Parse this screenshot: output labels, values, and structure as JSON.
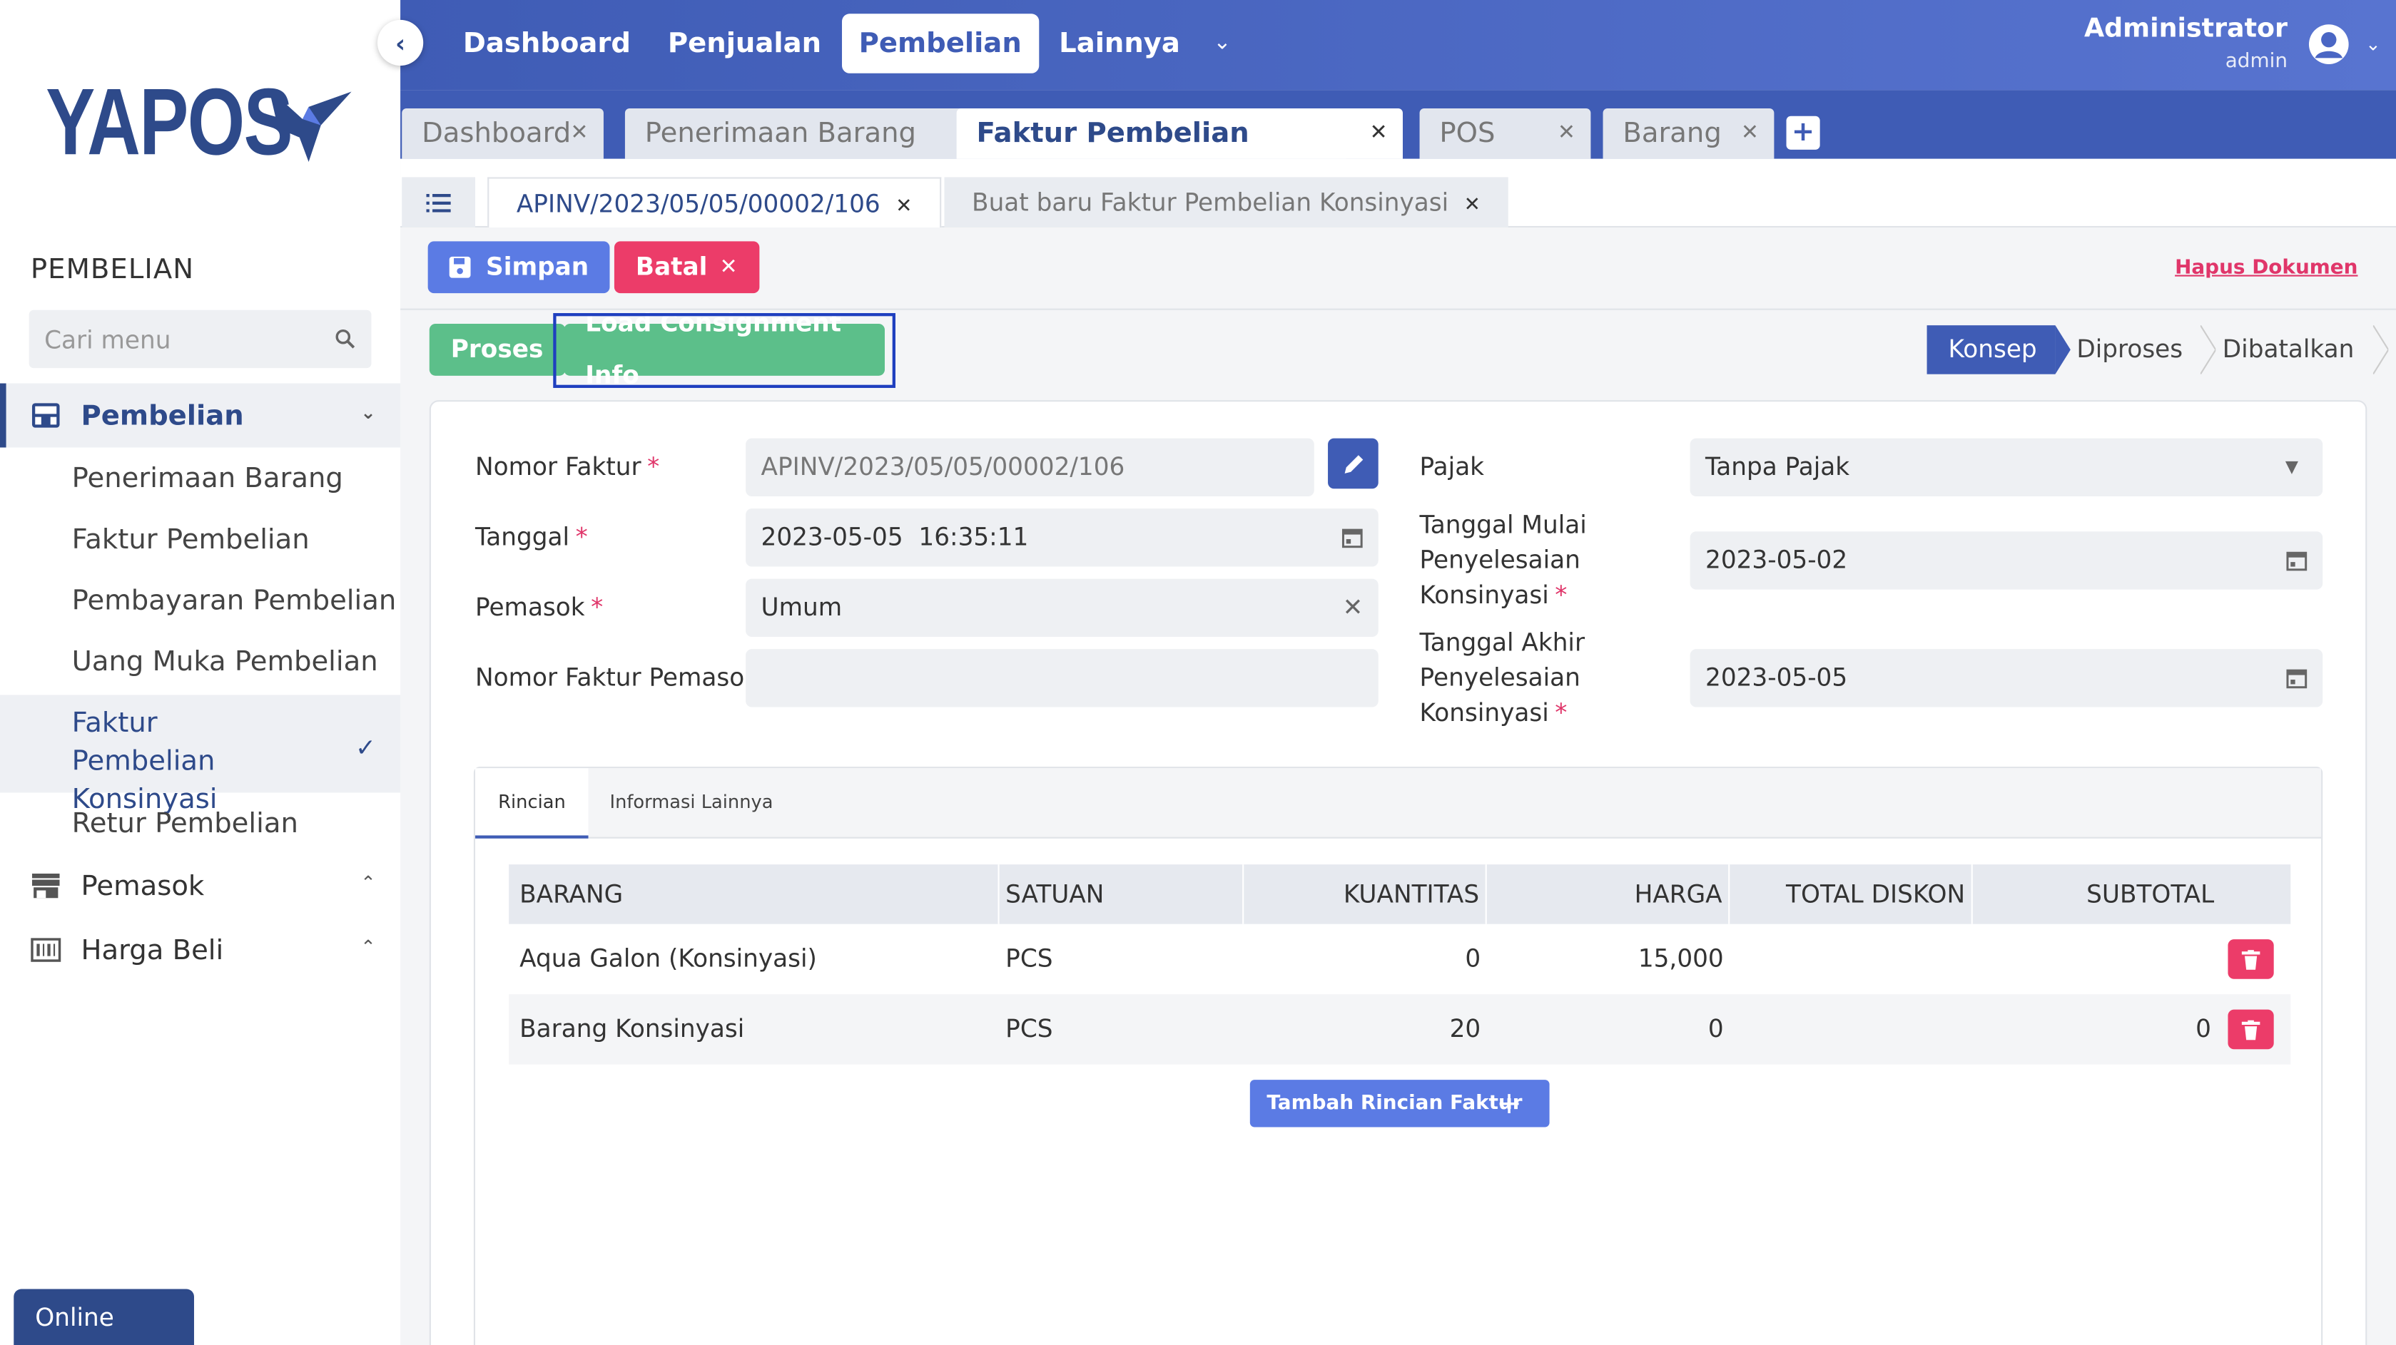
{
  "brand": {
    "name": "YAPOS"
  },
  "sidebar": {
    "section_title": "PEMBELIAN",
    "search_placeholder": "Cari menu",
    "groups": [
      {
        "label": "Pembelian",
        "icon": "inbox-icon",
        "expanded": true
      },
      {
        "label": "Pemasok",
        "icon": "store-icon",
        "expanded": false
      },
      {
        "label": "Harga Beli",
        "icon": "barcode-icon",
        "expanded": false
      }
    ],
    "items": [
      {
        "label": "Penerimaan Barang"
      },
      {
        "label": "Faktur Pembelian"
      },
      {
        "label": "Pembayaran Pembelian"
      },
      {
        "label": "Uang Muka Pembelian"
      },
      {
        "label": "Faktur Pembelian Konsinyasi",
        "active": true
      },
      {
        "label": "Retur Pembelian"
      }
    ],
    "status": "Online"
  },
  "topnav": {
    "items": [
      "Dashboard",
      "Penjualan",
      "Pembelian",
      "Lainnya"
    ],
    "active": "Pembelian",
    "user_name": "Administrator",
    "user_role": "admin"
  },
  "tabs": [
    {
      "label": "Dashboard"
    },
    {
      "label": "Penerimaan Barang"
    },
    {
      "label": "Faktur Pembelian Konsinyasi",
      "active": true
    },
    {
      "label": "POS"
    },
    {
      "label": "Barang"
    }
  ],
  "doc_tabs": [
    {
      "label": "APINV/2023/05/05/00002/106",
      "active": true
    },
    {
      "label": "Buat baru Faktur Pembelian Konsinyasi"
    }
  ],
  "actions": {
    "save": "Simpan",
    "cancel": "Batal",
    "delete_doc": "Hapus Dokumen",
    "process": "Proses",
    "load_consignment": "Load Consignment Info"
  },
  "status_steps": [
    "Konsep",
    "Diproses",
    "Dibatalkan"
  ],
  "status_active": "Konsep",
  "form": {
    "nomor_faktur_label": "Nomor Faktur",
    "nomor_faktur_value": "APINV/2023/05/05/00002/106",
    "tanggal_label": "Tanggal",
    "tanggal_value": "2023-05-05  16:35:11",
    "pemasok_label": "Pemasok",
    "pemasok_value": "Umum",
    "nomor_faktur_pemasok_label": "Nomor Faktur Pemasok",
    "nomor_faktur_pemasok_value": "",
    "pajak_label": "Pajak",
    "pajak_value": "Tanpa Pajak",
    "tgl_mulai_label_1": "Tanggal Mulai",
    "tgl_mulai_label_2": "Penyelesaian",
    "tgl_mulai_label_3": "Konsinyasi",
    "tgl_mulai_value": "2023-05-02",
    "tgl_akhir_label_1": "Tanggal Akhir",
    "tgl_akhir_label_2": "Penyelesaian",
    "tgl_akhir_label_3": "Konsinyasi",
    "tgl_akhir_value": "2023-05-05"
  },
  "detail": {
    "tabs": [
      "Rincian",
      "Informasi Lainnya"
    ],
    "columns": [
      "BARANG",
      "SATUAN",
      "KUANTITAS",
      "HARGA",
      "TOTAL DISKON",
      "SUBTOTAL"
    ],
    "rows": [
      {
        "barang": "Aqua Galon (Konsinyasi)",
        "satuan": "PCS",
        "kuantitas": "0",
        "harga": "15,000",
        "total_diskon": "",
        "subtotal": ""
      },
      {
        "barang": "Barang Konsinyasi",
        "satuan": "PCS",
        "kuantitas": "20",
        "harga": "0",
        "total_diskon": "",
        "subtotal": "0"
      }
    ],
    "add_row_label": "Tambah Rincian Faktur"
  },
  "colors": {
    "primary": "#3f5cb5",
    "button_blue": "#5b7be4",
    "danger": "#ec3c69",
    "success": "#5cbf8a",
    "brand_dark": "#2e4a8a"
  }
}
